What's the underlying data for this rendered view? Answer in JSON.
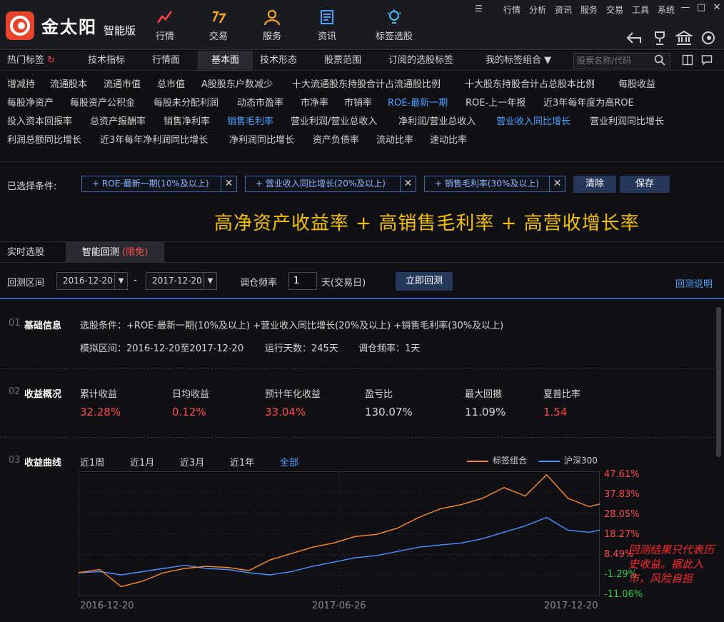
{
  "app": {
    "brand": "金太阳",
    "edition": "智能版"
  },
  "top_nav": [
    {
      "label": "行情",
      "icon": "trend-icon"
    },
    {
      "label": "交易",
      "icon": "trade-icon"
    },
    {
      "label": "服务",
      "icon": "user-service-icon"
    },
    {
      "label": "资讯",
      "icon": "news-icon"
    },
    {
      "label": "标签选股",
      "icon": "bulb-icon"
    }
  ],
  "system_menu": [
    "行情",
    "分析",
    "资讯",
    "服务",
    "交易",
    "工具",
    "系统"
  ],
  "tabs": [
    "热门标签",
    "技术指标",
    "行情面",
    "基本面",
    "技术形态",
    "股票范围",
    "订阅的选股标签",
    "我的标签组合 ▼"
  ],
  "search": {
    "placeholder": "股票名称/代码"
  },
  "indicators": {
    "row1": [
      "增减持",
      "流通股本",
      "流通市值",
      "总市值",
      "A股股东户数减少",
      "十大流通股东持股合计占流通股比例",
      "十大股东持股合计占总股本比例",
      "每股收益"
    ],
    "row2": [
      "每股净资产",
      "每股资产公积金",
      "每股未分配利润",
      "动态市盈率",
      "市净率",
      "市销率",
      "ROE-最新一期",
      "ROE-上一年报",
      "近3年每年度为高ROE"
    ],
    "row3": [
      "投入资本回报率",
      "总资产报酬率",
      "销售净利率",
      "销售毛利率",
      "营业利润/营业总收入",
      "净利润/营业总收入",
      "营业收入同比增长",
      "营业利润同比增长"
    ],
    "row4": [
      "利润总额同比增长",
      "近3年每年净利润同比增长",
      "净利润同比增长",
      "资产负债率",
      "流动比率",
      "速动比率"
    ]
  },
  "selected": {
    "label": "已选择条件:",
    "chips": [
      "+ ROE-最新一期(10%及以上)",
      "+ 营业收入同比增长(20%及以上)",
      "+ 销售毛利率(30%及以上)"
    ],
    "clear": "清除",
    "save": "保存"
  },
  "banner": "高净资产收益率 + 高销售毛利率 + 高营收增长率",
  "subtabs": {
    "realtime": "实时选股",
    "backtest": "智能回测",
    "backtest_badge": "(限免)"
  },
  "backtest": {
    "range_label": "回测区间",
    "start": "2016-12-20",
    "sep": "-",
    "end": "2017-12-20",
    "freq_label": "调仓频率",
    "freq": "1",
    "freq_unit": "天(交易日)",
    "run": "立即回测",
    "help": "回测说明"
  },
  "basic": {
    "num": "01",
    "title": "基础信息",
    "conditions": "选股条件：+ROE-最新一期(10%及以上)      +营业收入同比增长(20%及以上)      +销售毛利率(30%及以上)",
    "interval": "模拟区间：2016-12-20至2017-12-20",
    "days": "运行天数：245天",
    "freq": "调仓频率：1天"
  },
  "overview": {
    "num": "02",
    "title": "收益概况",
    "stats": [
      {
        "label": "累计收益",
        "value": "32.28%",
        "color": "#ff4a4a"
      },
      {
        "label": "日均收益",
        "value": "0.12%",
        "color": "#ff4a4a"
      },
      {
        "label": "预计年化收益",
        "value": "33.04%",
        "color": "#ff4a4a"
      },
      {
        "label": "盈亏比",
        "value": "130.07%",
        "color": "#d6d6d6"
      },
      {
        "label": "最大回撤",
        "value": "11.09%",
        "color": "#d6d6d6"
      },
      {
        "label": "夏普比率",
        "value": "1.54",
        "color": "#ff4a4a"
      }
    ]
  },
  "curve": {
    "num": "03",
    "title": "收益曲线",
    "periods": [
      "近1周",
      "近1月",
      "近3月",
      "近1年",
      "全部"
    ],
    "active_period": "全部"
  },
  "chart_data": {
    "type": "line",
    "x_ticks": [
      "2016-12-20",
      "2017-06-26",
      "2017-12-20"
    ],
    "y_ticks": [
      "47.61%",
      "37.83%",
      "28.05%",
      "18.27%",
      "8.49%",
      "-1.29%",
      "-11.06%"
    ],
    "ylim": [
      -11.06,
      47.61
    ],
    "grid": true,
    "legend_position": "top-right",
    "colors": {
      "series1": "#ff8a2a",
      "series2": "#4a90ff"
    },
    "x": [
      0,
      10,
      20,
      30,
      40,
      50,
      60,
      70,
      80,
      90,
      100,
      110,
      120,
      130,
      140,
      150,
      160,
      170,
      180,
      190,
      200,
      210,
      220,
      230,
      240,
      245
    ],
    "series": [
      {
        "name": "标签组合",
        "values": [
          0,
          1.5,
          -6.5,
          -4,
          0,
          2,
          3,
          2.5,
          1,
          6,
          9,
          12,
          14,
          17,
          18,
          21,
          26,
          30,
          32,
          35,
          40,
          36,
          46,
          35,
          31,
          32.28
        ]
      },
      {
        "name": "沪深300",
        "values": [
          0,
          0.5,
          -1,
          0.5,
          2,
          3.5,
          2,
          1.5,
          0,
          -1,
          0.5,
          3,
          5,
          7,
          8,
          10,
          12,
          13,
          14,
          16,
          19,
          22,
          26,
          20,
          19,
          20
        ]
      }
    ]
  },
  "warning": "回测结果只代表历史收益。据此入市，风险自担"
}
